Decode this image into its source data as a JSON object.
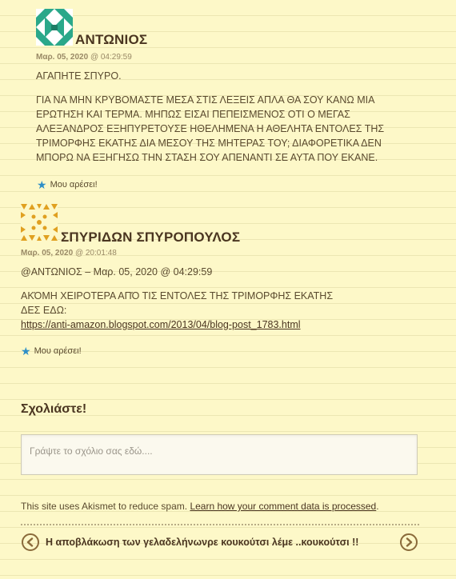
{
  "comments": [
    {
      "author": "ΑΝΤΩΝΙΟΣ",
      "date": "Μαρ. 05, 2020",
      "at": "@",
      "time": "04:29:59",
      "paragraphs": [
        "ΑΓΑΠΗΤΕ ΣΠΥΡΟ.",
        "ΓΙΑ ΝΑ ΜΗΝ ΚΡΥΒΟΜΑΣΤΕ ΜΕΣΑ ΣΤΙΣ ΛΕΞΕΙΣ ΑΠΛΑ ΘΑ ΣΟΥ ΚΑΝΩ ΜΙΑ ΕΡΩΤΗΣΗ ΚΑΙ ΤΕΡΜΑ. ΜΗΠΩΣ ΕΙΣΑΙ ΠΕΠΕΙΣΜΕΝΟΣ ΟΤΙ Ο ΜΕΓΑΣ ΑΛΕΞΑΝΔΡΟΣ ΕΞΗΠΥΡΕΤΟΥΣΕ ΗΘΕΛΗΜΕΝΑ Η ΑΘΕΛΗΤΑ ΕΝΤΟΛΕΣ ΤΗΣ ΤΡΙΜΟΡΦΗΣ ΕΚΑΤΗΣ ΔΙΑ ΜΕΣΟΥ ΤΗΣ ΜΗΤΕΡΑΣ ΤΟΥ; ΔΙΑΦΟΡΕΤΙΚΑ ΔΕΝ ΜΠΟΡΩ ΝΑ ΕΞΗΓΗΣΩ ΤΗΝ ΣΤΑΣΗ ΣΟΥ ΑΠΕΝΑΝΤΙ ΣΕ ΑΥΤΑ ΠΟΥ ΕΚΑΝΕ."
      ],
      "like_label": "Μου αρέσει!",
      "avatar_color": "#2aa88a"
    },
    {
      "author": "ΣΠΥΡΙΔΩΝ ΣΠΥΡΟΠΟΥΛΟΣ",
      "date": "Μαρ. 05, 2020",
      "at": "@",
      "time": "20:01:48",
      "reply_ref": "@ΑΝΤΩΝΙΟΣ – Μαρ. 05, 2020 @ 04:29:59",
      "line1": "ΑΚΌΜΗ ΧΕΙΡΟΤΕΡΑ ΑΠΌ ΤΙΣ ΕΝΤΟΛΕΣ ΤΗΣ ΤΡΙΜΟΡΦΗΣ ΕΚΑΤΗΣ",
      "line2": "ΔΕΣ ΕΔΩ:",
      "link": "https://anti-amazon.blogspot.com/2013/04/blog-post_1783.html",
      "like_label": "Μου αρέσει!",
      "avatar_color": "#e0a020"
    }
  ],
  "reply_section": {
    "title": "Σχολιάστε!",
    "placeholder": "Γράψτε το σχόλιο σας εδώ...."
  },
  "akismet": {
    "text": "This site uses Akismet to reduce spam.",
    "link": "Learn how your comment data is processed",
    "end": "."
  },
  "post_nav": {
    "text": "Η αποβλάκωση των γελαδελήνωνρε κουκούτσι λέμε ..κουκούτσι !!"
  },
  "colors": {
    "background": "#fdf8c8",
    "heading": "#4a3520",
    "like_star": "#2e8fc7"
  }
}
